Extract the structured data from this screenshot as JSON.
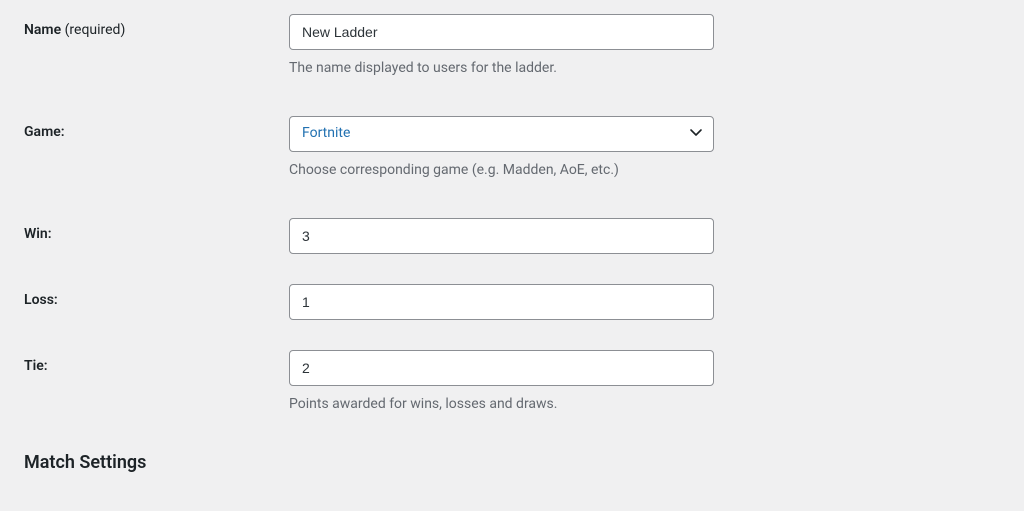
{
  "fields": {
    "name": {
      "label": "Name",
      "required_suffix": "(required)",
      "value": "New Ladder",
      "description": "The name displayed to users for the ladder."
    },
    "game": {
      "label": "Game:",
      "selected": "Fortnite",
      "description": "Choose corresponding game (e.g. Madden, AoE, etc.)"
    },
    "win": {
      "label": "Win:",
      "value": "3"
    },
    "loss": {
      "label": "Loss:",
      "value": "1"
    },
    "tie": {
      "label": "Tie:",
      "value": "2",
      "description": "Points awarded for wins, losses and draws."
    }
  },
  "section_title": "Match Settings"
}
